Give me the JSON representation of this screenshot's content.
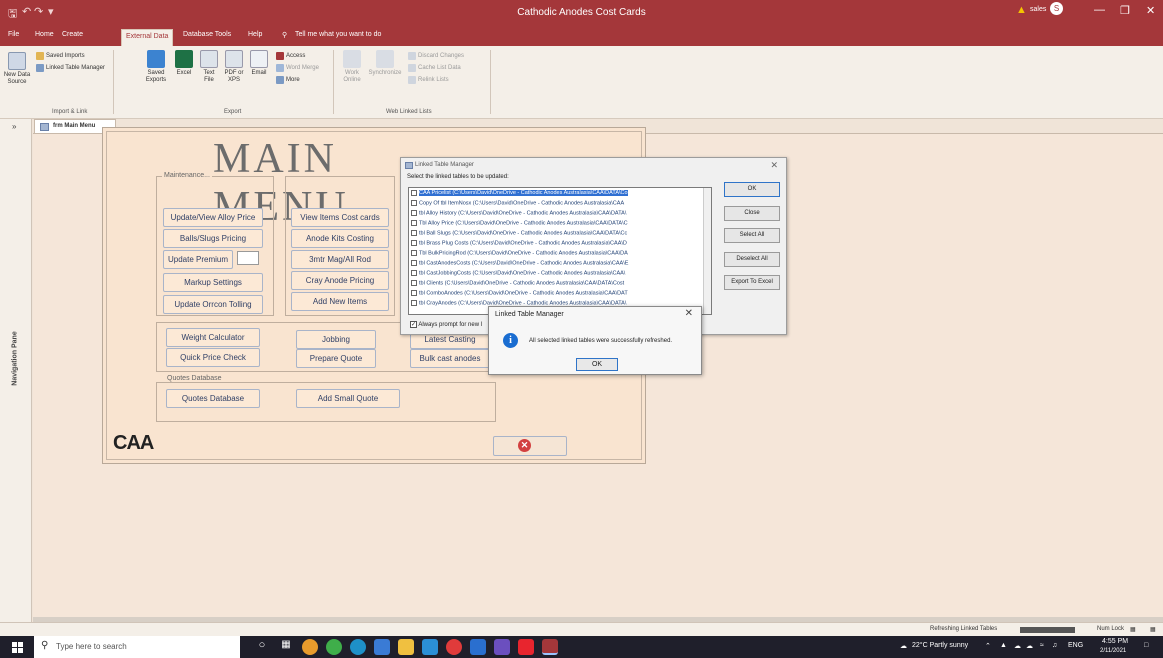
{
  "app": {
    "title": "Cathodic Anodes Cost Cards",
    "user": "sales",
    "user_initial": "S",
    "tell_me": "Tell me what you want to do"
  },
  "menu_tabs": [
    "File",
    "Home",
    "Create",
    "External Data",
    "Database Tools",
    "Help"
  ],
  "ribbon": {
    "new_data_source": "New Data Source",
    "saved_imports": "Saved Imports",
    "linked_table_manager": "Linked Table Manager",
    "group_import": "Import & Link",
    "saved_exports": "Saved Exports",
    "excel": "Excel",
    "text_file": "Text File",
    "pdf_xps": "PDF or XPS",
    "email": "Email",
    "access": "Access",
    "word_merge": "Word Merge",
    "more": "More",
    "group_export": "Export",
    "work_online": "Work Online",
    "synchronize": "Synchronize",
    "discard_changes": "Discard Changes",
    "cache_list_data": "Cache List Data",
    "relink_lists": "Relink Lists",
    "group_web": "Web Linked Lists"
  },
  "nav_pane_label": "Navigation Pane",
  "doc_tab": "frm Main Menu",
  "form": {
    "title": "MAIN MENU",
    "maintenance_label": "Maintenance...",
    "quotes_label": "Quotes Database",
    "buttons_left": [
      "Update/View Alloy Price",
      "Balls/Slugs Pricing",
      "Update Premium",
      "Markup Settings",
      "Update Orrcon Tolling"
    ],
    "buttons_mid": [
      "View Items Cost cards",
      "Anode Kits Costing",
      "3mtr Mag/All Rod",
      "Cray Anode Pricing",
      "Add New Items"
    ],
    "calc_left": [
      "Weight Calculator",
      "Quick Price Check"
    ],
    "calc_mid": [
      "Jobbing",
      "Prepare Quote"
    ],
    "calc_right": [
      "Latest Casting",
      "Bulk cast anodes"
    ],
    "quotes_db_button": "Quotes Database",
    "add_small_quote_button": "Add Small Quote",
    "logo": "CAA"
  },
  "ltm_dialog": {
    "title": "Linked Table Manager",
    "prompt": "Select the linked tables to be updated:",
    "tables": [
      "CAA Pricelist   (C:\\Users\\David\\OneDrive - Cathodic Anodes Australasia\\CAA\\DATA\\Co",
      "Copy Of tbl ItemNosx   (C:\\Users\\David\\OneDrive - Cathodic Anodes Australasia\\CAA",
      "tbl Alloy History   (C:\\Users\\David\\OneDrive - Cathodic Anodes Australasia\\CAA\\DATA\\",
      "Tbl Alloy Price   (C:\\Users\\David\\OneDrive - Cathodic Anodes Australasia\\CAA\\DATA\\C",
      "tbl Ball Slugs   (C:\\Users\\David\\OneDrive - Cathodic Anodes Australasia\\CAA\\DATA\\Cc",
      "tbl Brass Plug Costs   (C:\\Users\\David\\OneDrive - Cathodic Anodes Australasia\\CAA\\D",
      "Tbl BulkPricingRod   (C:\\Users\\David\\OneDrive - Cathodic Anodes Australasia\\CAA\\DA",
      "tbl CastAnodesCosts   (C:\\Users\\David\\OneDrive - Cathodic Anodes Australasia\\CAA\\E",
      "tbl CastJobbingCosts   (C:\\Users\\David\\OneDrive - Cathodic Anodes Australasia\\CAA\\",
      "tbl Clients   (C:\\Users\\David\\OneDrive - Cathodic Anodes Australasia\\CAA\\DATA\\Cost",
      "tbl ComboAnodes   (C:\\Users\\David\\OneDrive - Cathodic Anodes Australasia\\CAA\\DAT",
      "tbl CrayAnodes   (C:\\Users\\David\\OneDrive - Cathodic Anodes Australasia\\CAA\\DATA\\"
    ],
    "ok": "OK",
    "close": "Close",
    "select_all": "Select All",
    "deselect_all": "Deselect All",
    "export_excel": "Export To Excel",
    "always_prompt": "Always prompt for new l"
  },
  "message_box": {
    "title": "Linked Table Manager",
    "text": "All selected linked tables were successfully refreshed.",
    "ok": "OK"
  },
  "status": {
    "left": "Refreshing Linked Tables",
    "num_lock": "Num Lock"
  },
  "taskbar": {
    "search_placeholder": "Type here to search",
    "weather": "22°C  Partly sunny",
    "lang": "ENG",
    "time": "4:55 PM",
    "date": "2/11/2021"
  },
  "colors": {
    "title_bar": "#a4373a",
    "form_bg": "#f9e4d0",
    "button_text": "#2f3f66",
    "selection": "#2f6fd2"
  }
}
